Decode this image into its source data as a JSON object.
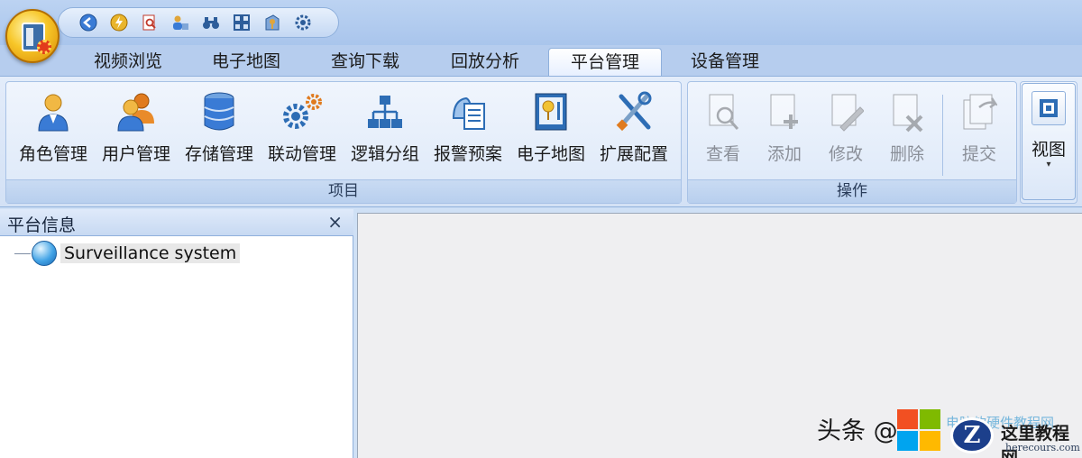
{
  "tabs": [
    {
      "label": "视频浏览"
    },
    {
      "label": "电子地图"
    },
    {
      "label": "查询下载"
    },
    {
      "label": "回放分析"
    },
    {
      "label": "平台管理"
    },
    {
      "label": "设备管理"
    }
  ],
  "active_tab": "平台管理",
  "ribbon": {
    "project_group": {
      "label": "项目",
      "buttons": [
        {
          "label": "角色管理",
          "icon": "role-icon"
        },
        {
          "label": "用户管理",
          "icon": "users-icon"
        },
        {
          "label": "存储管理",
          "icon": "database-icon"
        },
        {
          "label": "联动管理",
          "icon": "gears-icon"
        },
        {
          "label": "逻辑分组",
          "icon": "hierarchy-icon"
        },
        {
          "label": "报警预案",
          "icon": "alarm-plan-icon"
        },
        {
          "label": "电子地图",
          "icon": "map-icon"
        },
        {
          "label": "扩展配置",
          "icon": "tools-icon"
        }
      ]
    },
    "operation_group": {
      "label": "操作",
      "buttons": [
        {
          "label": "查看",
          "icon": "view-doc-icon",
          "enabled": false
        },
        {
          "label": "添加",
          "icon": "add-doc-icon",
          "enabled": false
        },
        {
          "label": "修改",
          "icon": "edit-doc-icon",
          "enabled": false
        },
        {
          "label": "删除",
          "icon": "delete-doc-icon",
          "enabled": false
        },
        {
          "label": "提交",
          "icon": "submit-doc-icon",
          "enabled": false
        }
      ]
    },
    "view_button": {
      "label": "视图",
      "arrow": "▾"
    }
  },
  "left_panel": {
    "title": "平台信息",
    "close": "×",
    "tree": [
      {
        "label": "Surveillance system"
      }
    ]
  },
  "watermark": {
    "text": "头条 @",
    "faded": "电脑软硬件教程网",
    "circle_letter": "Z",
    "brand_cn": "这里教程网",
    "brand_url": "herecours.com"
  },
  "colors": {
    "ribbon_bg": "#dce8f8",
    "tab_bar": "#b6cdee",
    "accent_blue": "#2d6db5",
    "disabled_text": "#8a8f98"
  }
}
